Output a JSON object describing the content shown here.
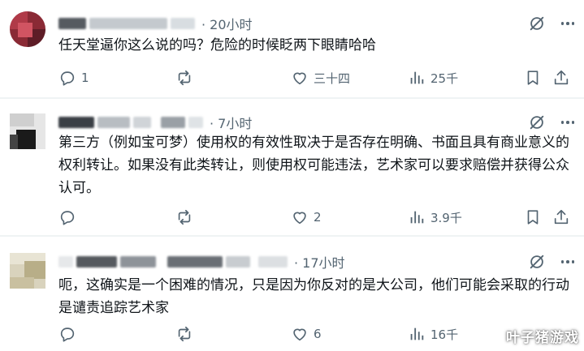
{
  "icons": {
    "reply": "reply-icon",
    "repost": "repost-icon",
    "like": "heart-icon",
    "views": "views-icon",
    "bookmark": "bookmark-icon",
    "share": "share-icon",
    "grok": "grok-icon",
    "more": "more-icon"
  },
  "colors": {
    "text": "#0f1419",
    "muted": "#536471",
    "divider": "#eff3f4"
  },
  "posts": [
    {
      "time": "· 20小时",
      "text": "任天堂逼你这么说的吗？危险的时候眨两下眼睛哈哈",
      "stats": {
        "replies": "1",
        "reposts": "",
        "likes": "三十四",
        "views": "25千"
      }
    },
    {
      "time": "· 7小时",
      "text": "第三方（例如宝可梦）使用权的有效性取决于是否存在明确、书面且具有商业意义的权利转让。如果没有此类转让，则使用权可能违法，艺术家可以要求赔偿并获得公众认可。",
      "stats": {
        "replies": "",
        "reposts": "",
        "likes": "2",
        "views": "3.9千"
      }
    },
    {
      "time": "· 17小时",
      "text": "呃，这确实是一个困难的情况，只是因为你反对的是大公司，他们可能会采取的行动是谴责追踪艺术家",
      "stats": {
        "replies": "",
        "reposts": "",
        "likes": "6",
        "views": "16千"
      }
    }
  ],
  "watermark": "叶子猪游戏"
}
